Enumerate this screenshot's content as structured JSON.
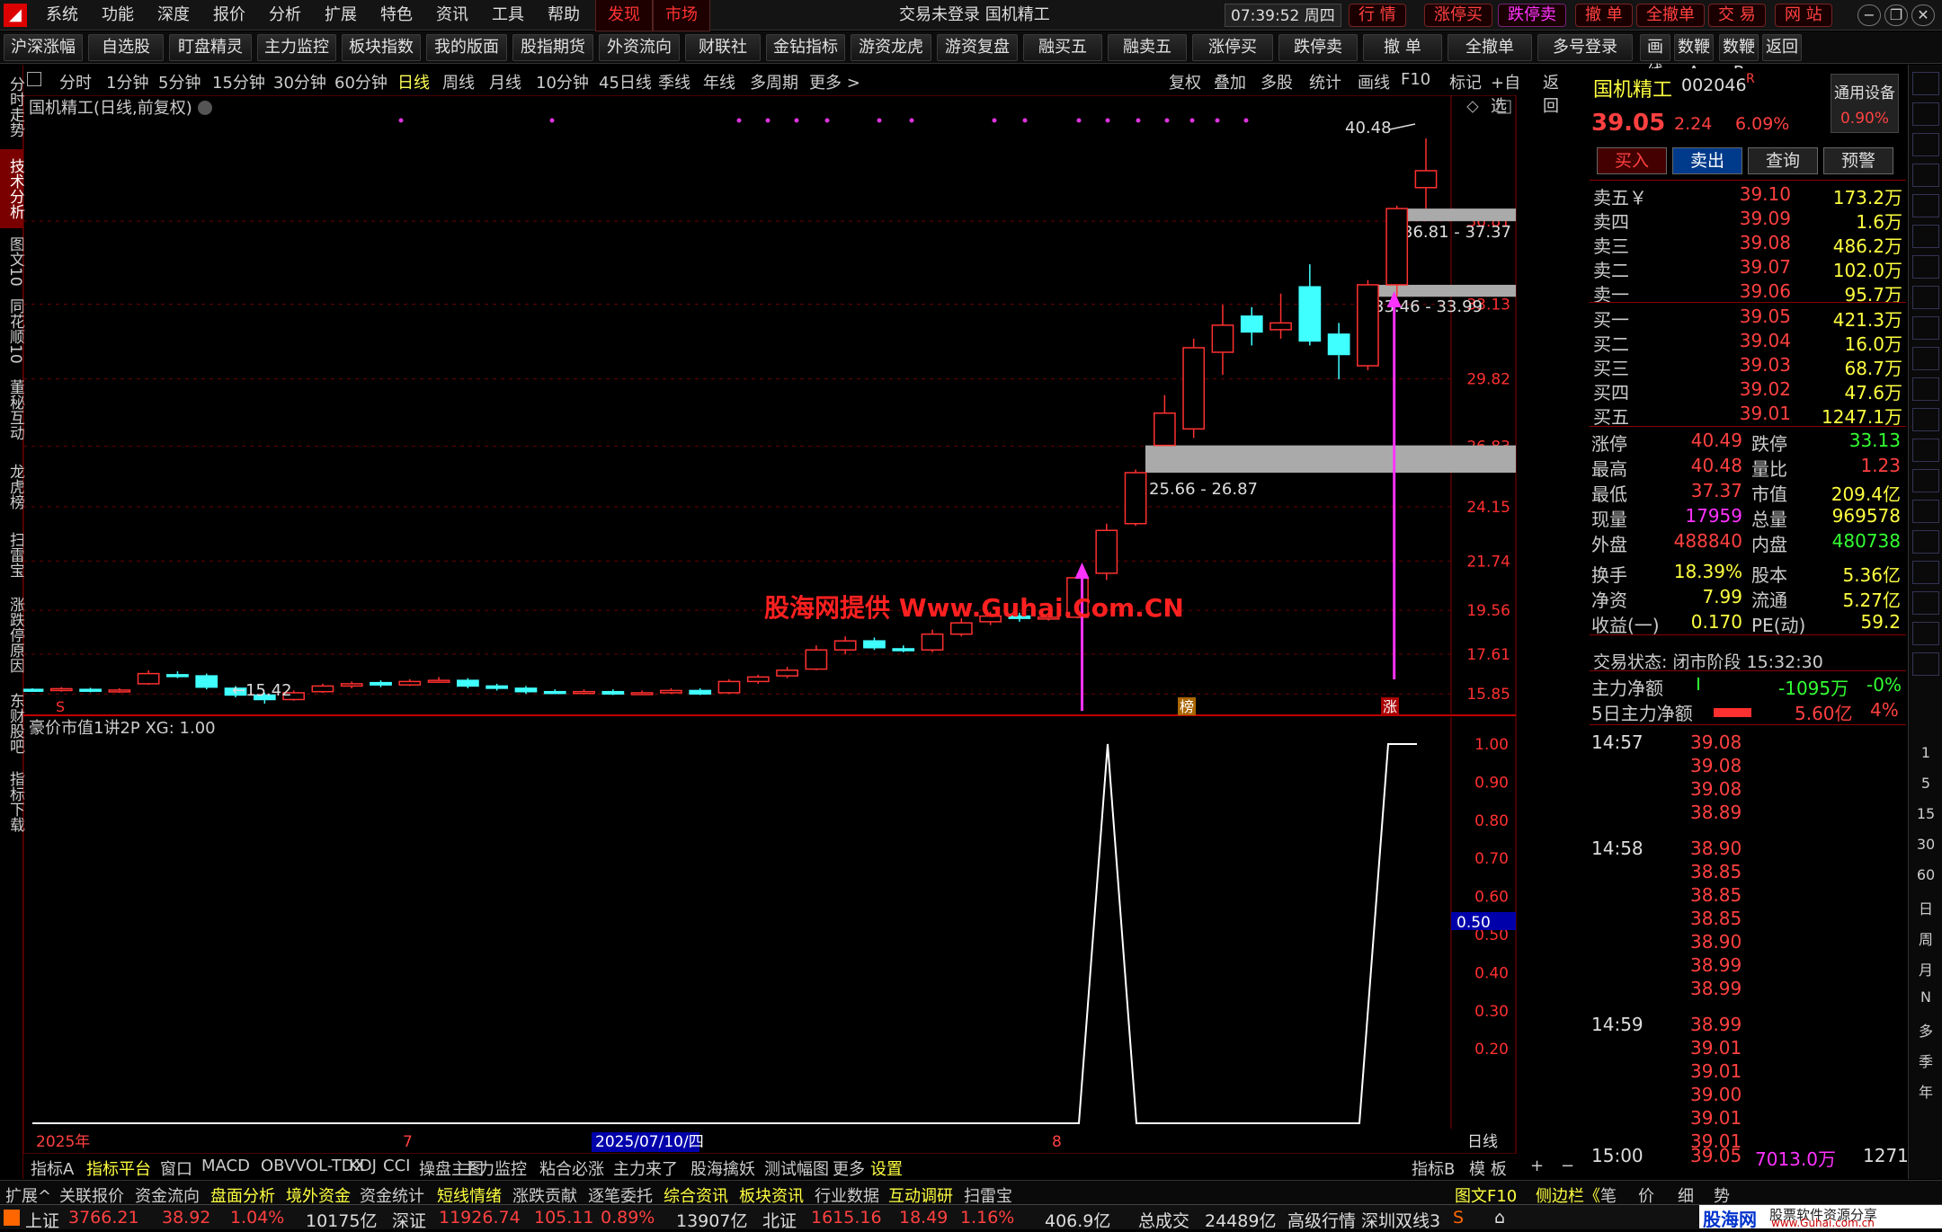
{
  "menu": [
    "系统",
    "功能",
    "深度",
    "报价",
    "分析",
    "扩展",
    "特色",
    "资讯",
    "工具",
    "帮助"
  ],
  "menu_hl": [
    "发现",
    "市场"
  ],
  "window_title": "交易未登录  国机精工",
  "clock": "07:39:52 周四",
  "title_buttons": [
    "行 情",
    "涨停买",
    "跌停卖",
    "撤 单",
    "全撤单",
    "交 易",
    "网 站"
  ],
  "toolbar": [
    "沪深涨幅",
    "自选股",
    "盯盘精灵",
    "主力监控",
    "板块指数",
    "我的版面",
    "股指期货",
    "外资流向",
    "财联社",
    "金钻指标",
    "游资龙虎",
    "游资复盘",
    "融买五",
    "融卖五",
    "涨停买",
    "跌停卖",
    "撤 单",
    "全撤单",
    "多号登录",
    "画线",
    "数鞭A",
    "数鞭B",
    "返回"
  ],
  "left_nav": [
    "分时走势",
    "技术分析",
    "图文10",
    "同花顺10",
    "董秘互动",
    "龙虎榜",
    "扫雷宝",
    "涨跌停原因",
    "东财股吧",
    "指标下载"
  ],
  "periods": [
    "分时",
    "1分钟",
    "5分钟",
    "15分钟",
    "30分钟",
    "60分钟",
    "日线",
    "周线",
    "月线",
    "10分钟",
    "45日线",
    "季线",
    "年线",
    "多周期",
    "更多 >"
  ],
  "chart_tools": [
    "复权",
    "叠加",
    "多股",
    "统计",
    "画线",
    "F10",
    "标记",
    "+自选",
    "返回"
  ],
  "chart_header": "国机精工(日线,前复权)",
  "indicator_header": "豪价市值1讲2P  XG: 1.00",
  "watermark": "股海网提供 Www.Guhai.Com.CN",
  "low_label": "←15.42",
  "high_label": "40.48",
  "zone_labels": [
    "36.81 - 37.37",
    "33.46 - 33.99",
    "25.66 - 26.87"
  ],
  "badge_bang": "榜",
  "badge_zhang": "涨",
  "badge_s": "S",
  "date_labels": [
    "2025年",
    "7",
    "2025/07/10/四",
    "8"
  ],
  "period_label": "日线",
  "cursor_value": "0.50",
  "chart_data": {
    "type": "candlestick",
    "price_axis": [
      "36.81",
      "33.13",
      "29.82",
      "26.83",
      "24.15",
      "21.74",
      "19.56",
      "17.61",
      "15.85"
    ],
    "indicator_axis": [
      "1.00",
      "0.90",
      "0.80",
      "0.70",
      "0.60",
      "0.50",
      "0.40",
      "0.30",
      "0.20"
    ],
    "ylim": [
      15.42,
      40.48
    ],
    "candles": [
      [
        16.05,
        16.0,
        16.1,
        15.95
      ],
      [
        16.02,
        16.08,
        16.15,
        15.95
      ],
      [
        16.05,
        15.98,
        16.12,
        15.92
      ],
      [
        16.0,
        16.02,
        16.1,
        15.9
      ],
      [
        16.3,
        16.75,
        16.9,
        16.25
      ],
      [
        16.7,
        16.65,
        16.85,
        16.55
      ],
      [
        16.65,
        16.15,
        16.75,
        16.05
      ],
      [
        16.1,
        15.8,
        16.2,
        15.7
      ],
      [
        15.8,
        15.6,
        15.9,
        15.42
      ],
      [
        15.6,
        15.9,
        16.0,
        15.55
      ],
      [
        15.95,
        16.2,
        16.3,
        15.9
      ],
      [
        16.2,
        16.3,
        16.4,
        16.1
      ],
      [
        16.35,
        16.25,
        16.45,
        16.15
      ],
      [
        16.25,
        16.4,
        16.5,
        16.2
      ],
      [
        16.4,
        16.45,
        16.6,
        16.35
      ],
      [
        16.45,
        16.2,
        16.55,
        16.1
      ],
      [
        16.2,
        16.1,
        16.3,
        16.0
      ],
      [
        16.1,
        15.95,
        16.2,
        15.85
      ],
      [
        15.95,
        15.9,
        16.05,
        15.85
      ],
      [
        15.9,
        15.95,
        16.05,
        15.85
      ],
      [
        15.95,
        15.85,
        16.05,
        15.8
      ],
      [
        15.85,
        15.9,
        16.0,
        15.8
      ],
      [
        15.9,
        16.0,
        16.1,
        15.85
      ],
      [
        16.0,
        15.85,
        16.1,
        15.8
      ],
      [
        15.9,
        16.4,
        16.5,
        15.85
      ],
      [
        16.4,
        16.6,
        16.7,
        16.3
      ],
      [
        16.65,
        16.9,
        17.05,
        16.55
      ],
      [
        16.95,
        17.8,
        18.0,
        16.9
      ],
      [
        17.8,
        18.2,
        18.4,
        17.6
      ],
      [
        18.2,
        17.9,
        18.35,
        17.8
      ],
      [
        17.85,
        17.8,
        18.0,
        17.7
      ],
      [
        17.8,
        18.5,
        18.7,
        17.7
      ],
      [
        18.5,
        19.0,
        19.2,
        18.4
      ],
      [
        19.05,
        19.3,
        19.5,
        18.9
      ],
      [
        19.3,
        19.2,
        19.45,
        19.05
      ],
      [
        19.2,
        19.25,
        19.4,
        19.1
      ],
      [
        19.25,
        21.0,
        21.2,
        19.2
      ],
      [
        21.2,
        23.1,
        23.4,
        20.9
      ],
      [
        23.4,
        25.66,
        25.8,
        23.3
      ],
      [
        26.87,
        28.3,
        29.1,
        26.87
      ],
      [
        27.6,
        31.2,
        31.6,
        27.2
      ],
      [
        31.0,
        32.2,
        33.1,
        30.0
      ],
      [
        32.6,
        31.9,
        33.0,
        31.3
      ],
      [
        32.0,
        32.3,
        33.6,
        31.6
      ],
      [
        33.9,
        31.5,
        34.9,
        31.3
      ],
      [
        31.8,
        30.9,
        32.3,
        29.8
      ],
      [
        30.4,
        33.99,
        34.2,
        30.2
      ],
      [
        33.99,
        37.37,
        37.5,
        33.46
      ],
      [
        38.3,
        39.05,
        40.48,
        37.37
      ]
    ],
    "indicator": [
      0,
      0,
      1,
      0,
      0,
      0,
      0,
      0,
      0,
      1,
      1
    ]
  },
  "stock": {
    "name": "国机精工",
    "code": "002046",
    "tag": "R",
    "price": "39.05",
    "change": "2.24",
    "pct": "6.09%",
    "side_label": "通用设备",
    "side_pct": "0.90%"
  },
  "trade_buttons": [
    "买入",
    "卖出",
    "查询",
    "预警"
  ],
  "sells": [
    {
      "l": "卖五￥",
      "p": "39.10",
      "v": "173.2万"
    },
    {
      "l": "卖四",
      "p": "39.09",
      "v": "1.6万"
    },
    {
      "l": "卖三",
      "p": "39.08",
      "v": "486.2万"
    },
    {
      "l": "卖二",
      "p": "39.07",
      "v": "102.0万"
    },
    {
      "l": "卖一",
      "p": "39.06",
      "v": "95.7万"
    }
  ],
  "buys": [
    {
      "l": "买一",
      "p": "39.05",
      "v": "421.3万"
    },
    {
      "l": "买二",
      "p": "39.04",
      "v": "16.0万"
    },
    {
      "l": "买三",
      "p": "39.03",
      "v": "68.7万"
    },
    {
      "l": "买四",
      "p": "39.02",
      "v": "47.6万"
    },
    {
      "l": "买五",
      "p": "39.01",
      "v": "1247.1万"
    }
  ],
  "stats": [
    {
      "a": "涨停",
      "b": "40.49",
      "c": "跌停",
      "d": "33.13",
      "bc": "red",
      "dc": "green"
    },
    {
      "a": "最高",
      "b": "40.48",
      "c": "量比",
      "d": "1.23",
      "bc": "red",
      "dc": "red"
    },
    {
      "a": "最低",
      "b": "37.37",
      "c": "市值",
      "d": "209.4亿",
      "bc": "red",
      "dc": "yel"
    },
    {
      "a": "现量",
      "b": "17959",
      "c": "总量",
      "d": "969578",
      "bc": "mag",
      "dc": "yel"
    },
    {
      "a": "外盘",
      "b": "488840",
      "c": "内盘",
      "d": "480738",
      "bc": "red",
      "dc": "green"
    },
    {
      "a": "换手",
      "b": "18.39%",
      "c": "股本",
      "d": "5.36亿",
      "bc": "yel",
      "dc": "yel"
    },
    {
      "a": "净资",
      "b": "7.99",
      "c": "流通",
      "d": "5.27亿",
      "bc": "yel",
      "dc": "yel"
    },
    {
      "a": "收益(一)",
      "b": "0.170",
      "c": "PE(动)",
      "d": "59.2",
      "bc": "yel",
      "dc": "yel"
    }
  ],
  "trade_status": "交易状态: 闭市阶段 15:32:30",
  "main_flow": {
    "label": "主力净额",
    "v": "-1095万",
    "p": "-0%"
  },
  "main_flow5": {
    "label": "5日主力净额",
    "v": "5.60亿",
    "p": "4%"
  },
  "ticks": [
    {
      "t": "14:57",
      "p": "39.08"
    },
    {
      "t": "",
      "p": "39.08"
    },
    {
      "t": "",
      "p": "39.08"
    },
    {
      "t": "",
      "p": "38.89"
    },
    {
      "t": "14:58",
      "p": "38.90"
    },
    {
      "t": "",
      "p": "38.85"
    },
    {
      "t": "",
      "p": "38.85"
    },
    {
      "t": "",
      "p": "38.85"
    },
    {
      "t": "",
      "p": "38.90"
    },
    {
      "t": "",
      "p": "38.99"
    },
    {
      "t": "",
      "p": "38.99"
    },
    {
      "t": "14:59",
      "p": "38.99"
    },
    {
      "t": "",
      "p": "39.01"
    },
    {
      "t": "",
      "p": "39.01"
    },
    {
      "t": "",
      "p": "39.00"
    },
    {
      "t": "",
      "p": "39.01"
    },
    {
      "t": "",
      "p": "39.01"
    }
  ],
  "close_tick": {
    "t": "15:00",
    "p": "39.05",
    "v": "7013.0万",
    "n": "1271"
  },
  "right_strip": [
    "1",
    "5",
    "15",
    "30",
    "60",
    "日",
    "周",
    "月",
    "N",
    "多",
    "季",
    "年"
  ],
  "bottom_tabs": [
    "指标A",
    "指标平台",
    "窗口",
    "MACD",
    "OBV",
    "VOL-TDX",
    "KDJ",
    "CCI",
    "操盘主图",
    "主力监控",
    "粘合必涨",
    "主力来了",
    "股海擒妖",
    "测试幅图",
    "更多",
    "设置"
  ],
  "bottom_right_tabs": [
    "指标B",
    "模 板",
    "+",
    "−"
  ],
  "sub_tabs": [
    "扩展^",
    "关联报价",
    "资金流向",
    "盘面分析",
    "境外资金",
    "资金统计",
    "短线情绪",
    "涨跌贡献",
    "逐笔委托",
    "综合资讯",
    "板块资讯",
    "行业数据",
    "互动调研",
    "扫雷宝"
  ],
  "sub_right": [
    "图文F10",
    "侧边栏《",
    "笔",
    "价",
    "细",
    "势"
  ],
  "status": {
    "sh_label": "上证",
    "sh": "3766.21",
    "sh_chg": "38.92",
    "sh_pct": "1.04%",
    "sh_amt": "10175亿",
    "sz_label": "深证",
    "sz": "11926.74",
    "sz_chg": "105.11",
    "sz_pct": "0.89%",
    "sz_amt": "13907亿",
    "bj_label": "北证",
    "bj": "1615.16",
    "bj_chg": "18.49",
    "bj_pct": "1.16%",
    "bj_amt": "406.9亿",
    "total_label": "总成交",
    "total": "24489亿",
    "feed": "高级行情  深圳双线3",
    "brand": "股海网",
    "brand_sub": "股票软件资源分享",
    "brand_url": "www.Guhai.com.cn"
  }
}
